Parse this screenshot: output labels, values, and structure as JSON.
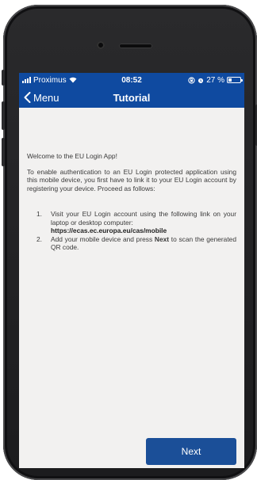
{
  "status_bar": {
    "carrier": "Proximus",
    "time": "08:52",
    "battery_text": "27 %",
    "battery_level": 0.27
  },
  "nav": {
    "back_label": "Menu",
    "title": "Tutorial"
  },
  "content": {
    "welcome": "Welcome to the EU Login App!",
    "intro": "To enable authentication to an EU Login protected application using this mobile device, you first have to link it to your EU Login account by registering your device. Proceed as follows:",
    "steps": [
      {
        "number": "1.",
        "text": "Visit your EU Login account using the following link on your laptop or desktop computer:",
        "link": "https://ecas.ec.europa.eu/cas/mobile"
      },
      {
        "number": "2.",
        "text_before": "Add your mobile device and press ",
        "bold": "Next",
        "text_after": " to scan the generated QR code."
      }
    ]
  },
  "next_button": {
    "label": "Next"
  },
  "colors": {
    "header": "#0f4aa0",
    "button": "#1b4f98",
    "background": "#f2f1f0"
  }
}
